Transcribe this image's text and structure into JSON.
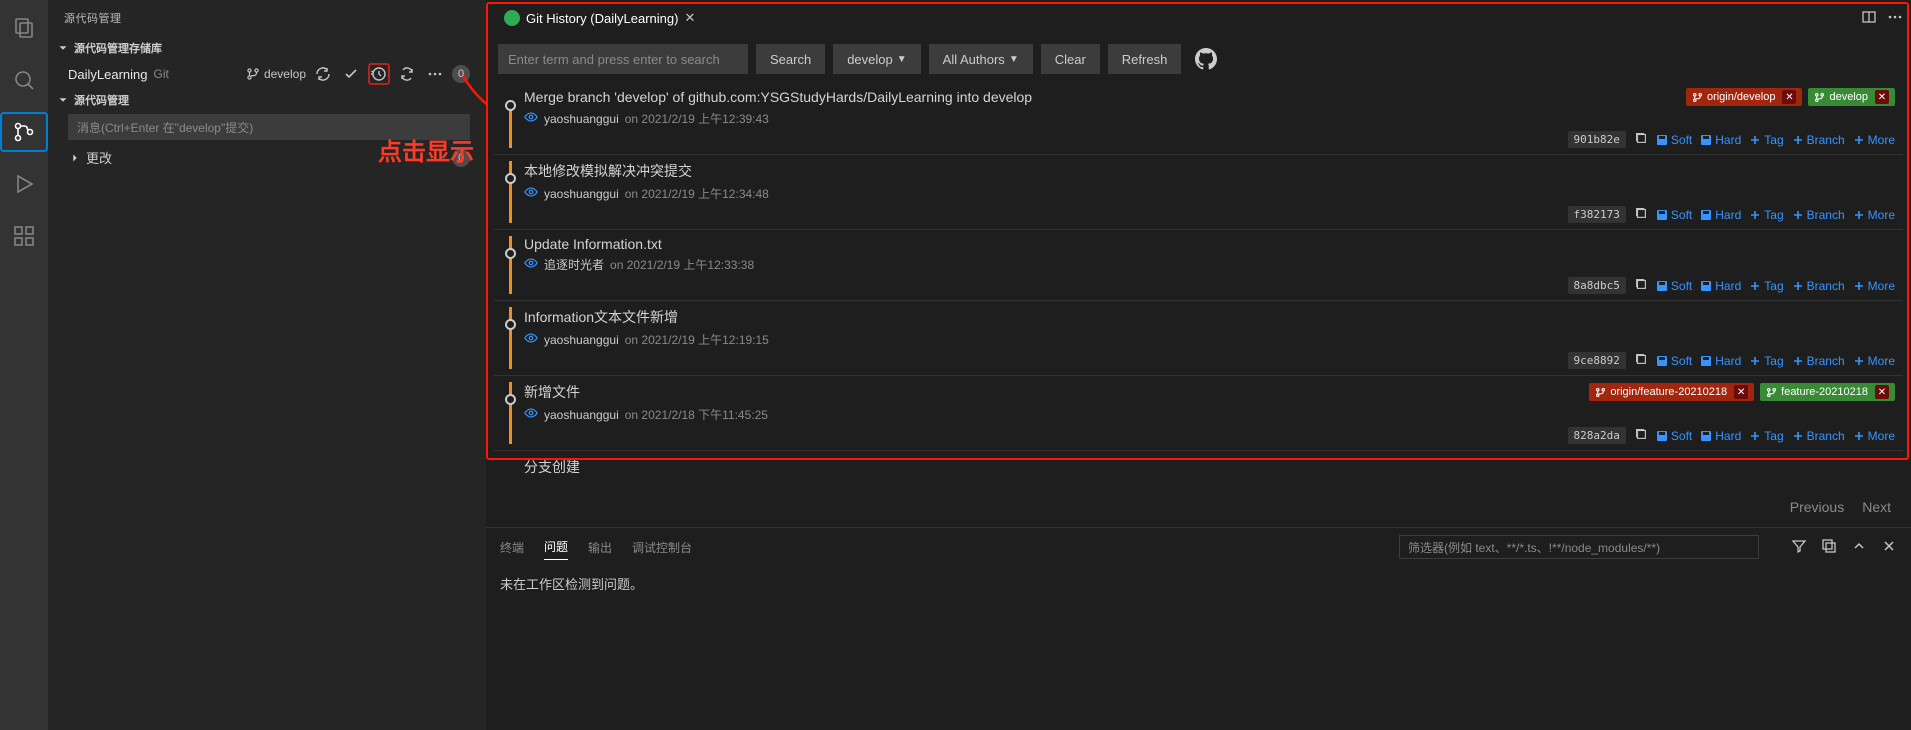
{
  "sidebar": {
    "title": "源代码管理",
    "repo_section": "源代码管理存储库",
    "repo_name": "DailyLearning",
    "repo_vcs": "Git",
    "branch": "develop",
    "badge": "0",
    "scm_section": "源代码管理",
    "message_placeholder": "消息(Ctrl+Enter 在\"develop\"提交)",
    "changes_label": "更改",
    "changes_count": "0"
  },
  "annotation": "点击显示",
  "tab": {
    "title": "Git History (DailyLearning)"
  },
  "toolbar": {
    "search_placeholder": "Enter term and press enter to search",
    "search": "Search",
    "branch": "develop",
    "authors": "All Authors",
    "clear": "Clear",
    "refresh": "Refresh"
  },
  "actions": {
    "soft": "Soft",
    "hard": "Hard",
    "tag": "Tag",
    "branch": "Branch",
    "more": "More"
  },
  "refs": {
    "origin_develop": "origin/develop",
    "develop": "develop",
    "origin_feature": "origin/feature-20210218",
    "feature": "feature-20210218"
  },
  "commits": [
    {
      "title": "Merge branch 'develop' of github.com:YSGStudyHards/DailyLearning into develop",
      "author": "yaoshuanggui",
      "date": "on 2021/2/19 上午12:39:43",
      "hash": "901b82e",
      "refs": [
        "origin_develop",
        "develop"
      ]
    },
    {
      "title": "本地修改模拟解决冲突提交",
      "author": "yaoshuanggui",
      "date": "on 2021/2/19 上午12:34:48",
      "hash": "f382173",
      "refs": []
    },
    {
      "title": "Update Information.txt",
      "author": "追逐时光者",
      "date": "on 2021/2/19 上午12:33:38",
      "hash": "8a8dbc5",
      "refs": []
    },
    {
      "title": "Information文本文件新增",
      "author": "yaoshuanggui",
      "date": "on 2021/2/19 上午12:19:15",
      "hash": "9ce8892",
      "refs": []
    },
    {
      "title": "新增文件",
      "author": "yaoshuanggui",
      "date": "on 2021/2/18 下午11:45:25",
      "hash": "828a2da",
      "refs": [
        "origin_feature",
        "feature"
      ]
    },
    {
      "title": "分支创建",
      "author": "",
      "date": "",
      "hash": "",
      "refs": []
    }
  ],
  "pager": {
    "prev": "Previous",
    "next": "Next"
  },
  "panel": {
    "tabs": {
      "terminal": "终端",
      "problems": "问题",
      "output": "输出",
      "debug": "调试控制台"
    },
    "filter_placeholder": "筛选器(例如 text、**/*.ts、!**/node_modules/**)",
    "body": "未在工作区检测到问题。"
  }
}
